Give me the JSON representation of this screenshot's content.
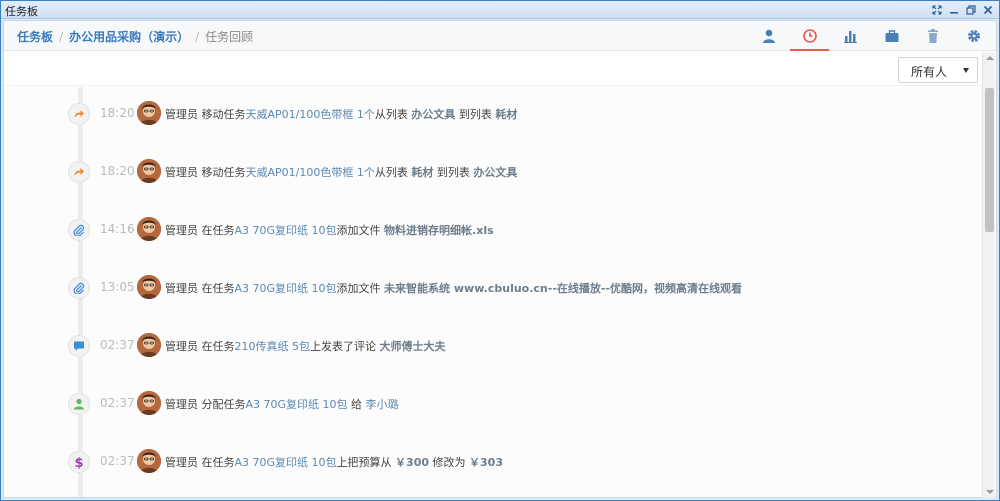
{
  "window": {
    "title": "任务板"
  },
  "breadcrumb": {
    "root": "任务板",
    "project": "办公用品采购（演示）",
    "current": "任务回顾"
  },
  "toolbar": {
    "items": [
      "user-icon",
      "clock-icon",
      "bar-chart-icon",
      "briefcase-icon",
      "trash-icon",
      "gear-icon"
    ],
    "active": "clock-icon"
  },
  "filter": {
    "selected": "所有人"
  },
  "colors": {
    "accent": "#3a7bbf",
    "active_tab": "#e55b4d",
    "link": "#5b88b2"
  },
  "entries": [
    {
      "icon": "forward-arrow-icon",
      "time": "18:20",
      "user": "管理员",
      "pre": "移动任务",
      "link": "天威AP01/100色带框 1个",
      "mid": "从列表 ",
      "b1": "办公文具",
      "mid2": " 到列表 ",
      "b2": "耗材"
    },
    {
      "icon": "forward-arrow-icon",
      "time": "18:20",
      "user": "管理员",
      "pre": "移动任务",
      "link": "天威AP01/100色带框 1个",
      "mid": "从列表 ",
      "b1": "耗材",
      "mid2": " 到列表 ",
      "b2": "办公文具"
    },
    {
      "icon": "paperclip-icon",
      "time": "14:16",
      "user": "管理员",
      "pre": "在任务",
      "link": "A3 70G复印纸 10包",
      "mid": "添加文件 ",
      "b1": "物料进销存明细帐.xls",
      "mid2": "",
      "b2": ""
    },
    {
      "icon": "paperclip-icon",
      "time": "13:05",
      "user": "管理员",
      "pre": "在任务",
      "link": "A3 70G复印纸 10包",
      "mid": "添加文件 ",
      "b1": "未来智能系统 www.cbuluo.cn--在线播放--优酷网，视频高清在线观看",
      "mid2": "",
      "b2": ""
    },
    {
      "icon": "comment-icon",
      "time": "02:37",
      "user": "管理员",
      "pre": "在任务",
      "link": "210传真纸 5包",
      "mid": "上发表了评论 ",
      "b1": "大师傅士大夫",
      "mid2": "",
      "b2": ""
    },
    {
      "icon": "user-assign-icon",
      "time": "02:37",
      "user": "管理员",
      "pre": "分配任务",
      "link": "A3 70G复印纸 10包",
      "mid": " 给 ",
      "b1": "",
      "mid2": "",
      "b2": "",
      "tail_link": "李小璐"
    },
    {
      "icon": "dollar-icon",
      "time": "02:37",
      "user": "管理员",
      "pre": "在任务",
      "link": "A3 70G复印纸 10包",
      "mid": "上把预算从 ",
      "b1": "￥300",
      "mid2": " 修改为 ",
      "b2": "￥303"
    }
  ]
}
